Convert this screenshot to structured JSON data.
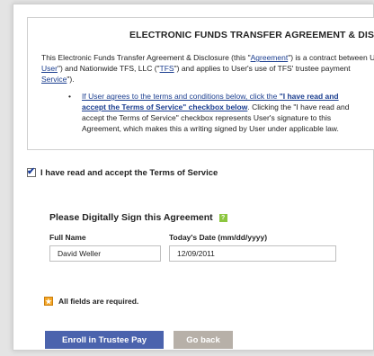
{
  "terms": {
    "title": "ELECTRONIC FUNDS TRANSFER AGREEMENT & DISCLOSURE",
    "intro_1_a": "This Electronic Funds Transfer Agreement & Disclosure (this \"",
    "intro_1_link": "Agreement",
    "intro_1_b": "\") is a contract between User (\"",
    "intro_2_link1": "User",
    "intro_2_a": "\") and Nationwide TFS, LLC (\"",
    "intro_2_link2": "TFS",
    "intro_2_b": "\") and applies to User's use of TFS' trustee payment",
    "intro_3_link": "Service",
    "intro_3_a": "\").",
    "bullet_1_link": "If User agrees to the terms and conditions below, click the ",
    "bullet_1_bold": "\"I have read and",
    "bullet_2_bold": "accept the Terms of Service\" checkbox below",
    "bullet_2_a": ". Clicking the \"I have read and",
    "bullet_3": "accept the Terms of Service\" checkbox represents User's signature to this",
    "bullet_4": "Agreement, which makes this a writing signed by User under applicable law."
  },
  "accept": {
    "checked": true,
    "label": "I have read and accept the Terms of Service"
  },
  "signature": {
    "title": "Please Digitally Sign this Agreement",
    "help_icon": "help-icon",
    "full_name_label": "Full Name",
    "full_name_value": "David Weller",
    "date_label": "Today's Date (mm/dd/yyyy)",
    "date_value": "12/09/2011"
  },
  "required_note": "All fields are required.",
  "buttons": {
    "enroll": "Enroll in Trustee Pay",
    "back": "Go back"
  }
}
